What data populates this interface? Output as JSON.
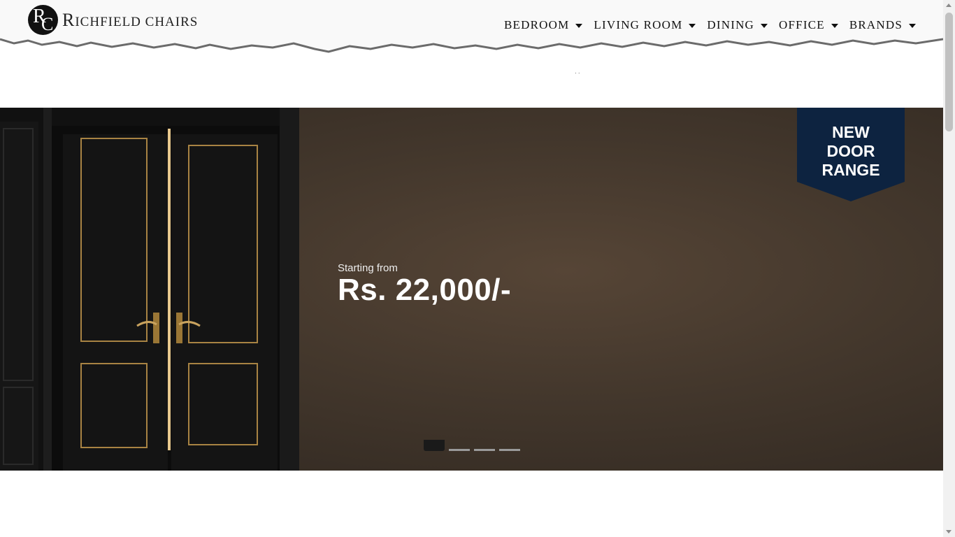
{
  "brand": {
    "initials_r": "R",
    "initials_c": "C",
    "name_first": "R",
    "name_rest": "ICHFIELD CHAIRS"
  },
  "nav": [
    {
      "label": "BEDROOM"
    },
    {
      "label": "LIVING ROOM"
    },
    {
      "label": "DINING"
    },
    {
      "label": "OFFICE"
    },
    {
      "label": "BRANDS"
    }
  ],
  "loading_dots": "·   ·",
  "hero": {
    "starting_from": "Starting from",
    "price": "Rs. 22,000/-",
    "badge": {
      "line1": "NEW",
      "line2": "DOOR",
      "line3": "RANGE"
    },
    "slides_total": 4,
    "active_slide": 1
  },
  "colors": {
    "badge_bg": "#0d2340",
    "hero_bg": "#43372c",
    "header_bg": "#f9f9f9"
  }
}
